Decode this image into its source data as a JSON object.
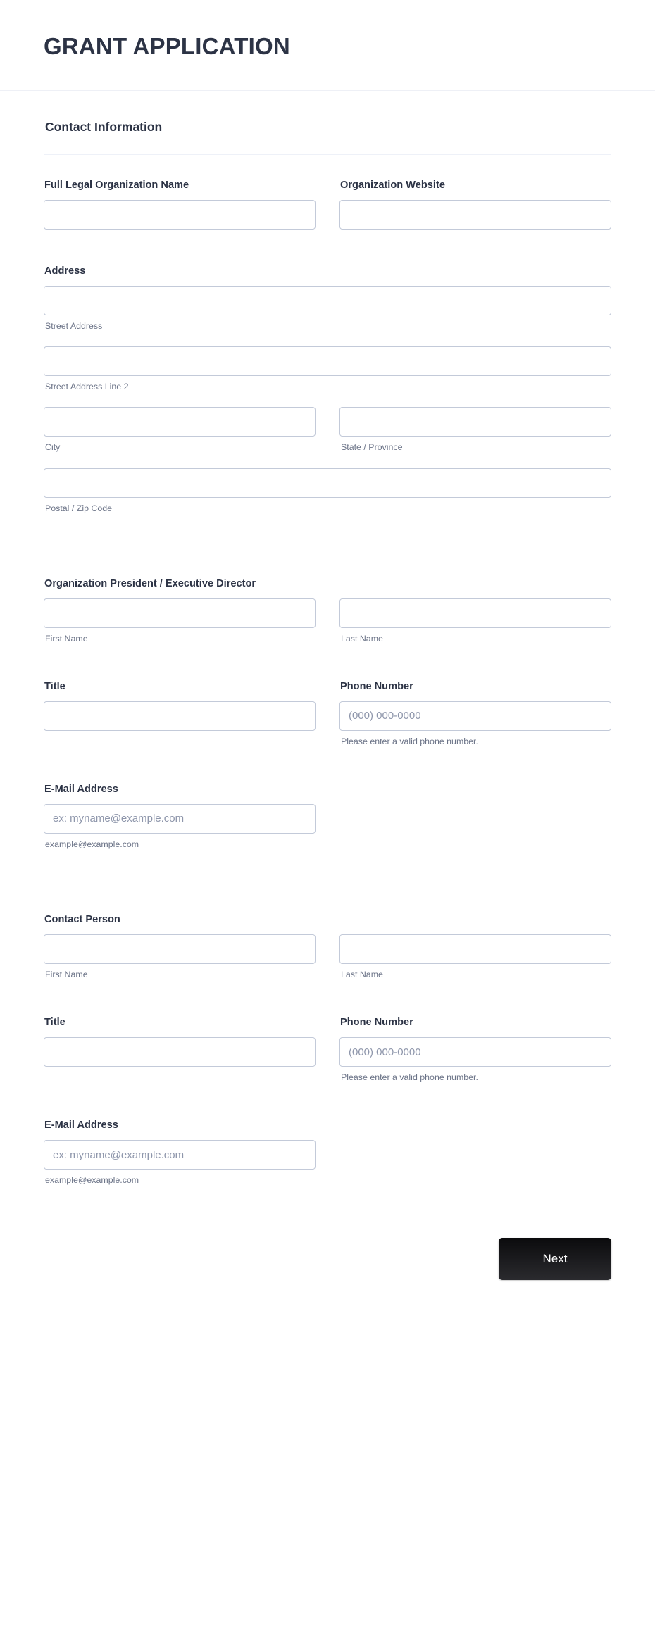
{
  "header": {
    "title": "GRANT APPLICATION"
  },
  "section": {
    "heading": "Contact Information"
  },
  "org": {
    "name_label": "Full Legal Organization Name",
    "name_value": "",
    "website_label": "Organization Website",
    "website_value": ""
  },
  "address": {
    "label": "Address",
    "street1_value": "",
    "street1_sub": "Street Address",
    "street2_value": "",
    "street2_sub": "Street Address Line 2",
    "city_value": "",
    "city_sub": "City",
    "state_value": "",
    "state_sub": "State / Province",
    "postal_value": "",
    "postal_sub": "Postal / Zip Code"
  },
  "president": {
    "label": "Organization President / Executive Director",
    "first_value": "",
    "first_sub": "First Name",
    "last_value": "",
    "last_sub": "Last Name",
    "title_label": "Title",
    "title_value": "",
    "phone_label": "Phone Number",
    "phone_value": "",
    "phone_placeholder": "(000) 000-0000",
    "phone_hint": "Please enter a valid phone number.",
    "email_label": "E-Mail Address",
    "email_value": "",
    "email_placeholder": "ex: myname@example.com",
    "email_hint": "example@example.com"
  },
  "contact_person": {
    "label": "Contact Person",
    "first_value": "",
    "first_sub": "First Name",
    "last_value": "",
    "last_sub": "Last Name",
    "title_label": "Title",
    "title_value": "",
    "phone_label": "Phone Number",
    "phone_value": "",
    "phone_placeholder": "(000) 000-0000",
    "phone_hint": "Please enter a valid phone number.",
    "email_label": "E-Mail Address",
    "email_value": "",
    "email_placeholder": "ex: myname@example.com",
    "email_hint": "example@example.com"
  },
  "footer": {
    "next_label": "Next"
  },
  "colors": {
    "text": "#2c3345",
    "sub_text": "#6b7387",
    "input_border": "#c3cad9",
    "divider": "#eef1f8",
    "button_bg": "#0b0b0d",
    "button_text": "#ffffff"
  }
}
